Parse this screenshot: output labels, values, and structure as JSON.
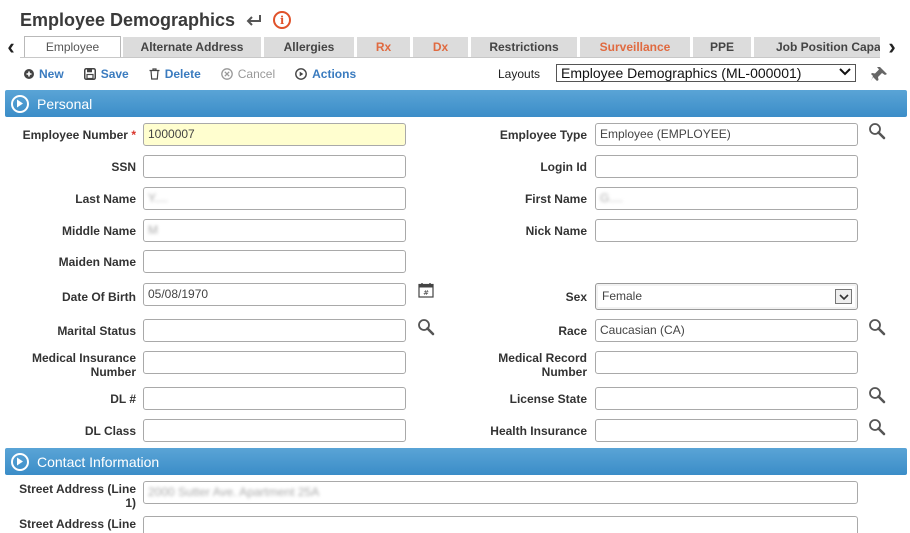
{
  "header": {
    "title": "Employee Demographics"
  },
  "tabs": [
    {
      "label": "Employee",
      "active": true
    },
    {
      "label": "Alternate Address"
    },
    {
      "label": "Allergies"
    },
    {
      "label": "Rx",
      "highlight": true
    },
    {
      "label": "Dx",
      "highlight": true
    },
    {
      "label": "Restrictions"
    },
    {
      "label": "Surveillance",
      "highlight": true
    },
    {
      "label": "PPE"
    },
    {
      "label": "Job Position Capat"
    }
  ],
  "toolbar": {
    "new_label": "New",
    "save_label": "Save",
    "delete_label": "Delete",
    "cancel_label": "Cancel",
    "actions_label": "Actions",
    "layouts_label": "Layouts",
    "layout_value": "Employee Demographics (ML-000001)"
  },
  "sections": {
    "personal": "Personal",
    "contact": "Contact Information"
  },
  "personal": {
    "employee_number": {
      "label": "Employee Number",
      "value": "1000007"
    },
    "employee_type": {
      "label": "Employee Type",
      "value": "Employee (EMPLOYEE)"
    },
    "ssn": {
      "label": "SSN",
      "value": ""
    },
    "login_id": {
      "label": "Login Id",
      "value": ""
    },
    "last_name": {
      "label": "Last Name",
      "value": "Y...."
    },
    "first_name": {
      "label": "First Name",
      "value": "G...."
    },
    "middle_name": {
      "label": "Middle Name",
      "value": "M"
    },
    "nick_name": {
      "label": "Nick Name",
      "value": ""
    },
    "maiden_name": {
      "label": "Maiden Name",
      "value": ""
    },
    "dob": {
      "label": "Date Of Birth",
      "value": "05/08/1970"
    },
    "sex": {
      "label": "Sex",
      "value": "Female"
    },
    "marital_status": {
      "label": "Marital Status",
      "value": ""
    },
    "race": {
      "label": "Race",
      "value": "Caucasian (CA)"
    },
    "med_ins_number": {
      "label_1": "Medical Insurance",
      "label_2": "Number",
      "value": ""
    },
    "med_record_number": {
      "label_1": "Medical Record",
      "label_2": "Number",
      "value": ""
    },
    "dl_number": {
      "label": "DL #",
      "value": ""
    },
    "license_state": {
      "label": "License State",
      "value": ""
    },
    "dl_class": {
      "label": "DL Class",
      "value": ""
    },
    "health_insurance": {
      "label": "Health Insurance",
      "value": ""
    }
  },
  "contact": {
    "street1": {
      "label_1": "Street Address (Line",
      "label_2": "1)",
      "value": "2000 Sutter Ave. Apartment 25A"
    },
    "street2": {
      "label_1": "Street Address (Line",
      "value": ""
    }
  },
  "colors": {
    "accent": "#3b8dc8",
    "link": "#3a7bbf",
    "highlight_tab": "#e06a40",
    "required": "#d9342b",
    "info": "#e0522a"
  }
}
